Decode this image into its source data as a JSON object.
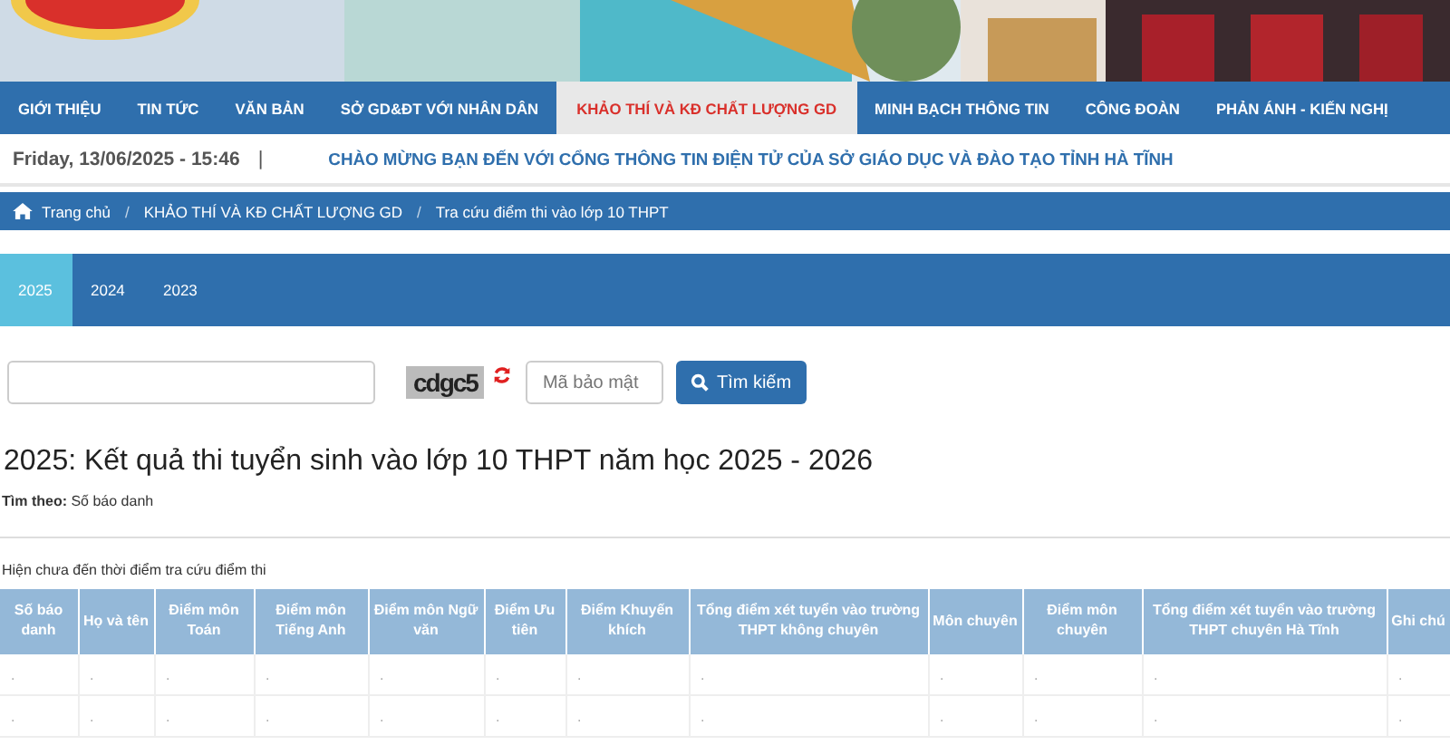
{
  "nav": [
    {
      "label": "GIỚI THIỆU",
      "selected": false
    },
    {
      "label": "TIN TỨC",
      "selected": false
    },
    {
      "label": "VĂN BẢN",
      "selected": false
    },
    {
      "label": "SỞ GD&ĐT VỚI NHÂN DÂN",
      "selected": false
    },
    {
      "label": "KHẢO THÍ VÀ KĐ CHẤT LƯỢNG GD",
      "selected": true
    },
    {
      "label": "MINH BẠCH THÔNG TIN",
      "selected": false
    },
    {
      "label": "CÔNG ĐOÀN",
      "selected": false
    },
    {
      "label": "PHẢN ÁNH - KIẾN NGHỊ",
      "selected": false
    }
  ],
  "date": "Friday, 13/06/2025 - 15:46",
  "separator": "|",
  "welcome": "CHÀO MỪNG BẠN ĐẾN VỚI CỔNG THÔNG TIN ĐIỆN TỬ CỦA SỞ GIÁO DỤC VÀ ĐÀO TẠO TỈNH HÀ TĨNH",
  "breadcrumb": [
    "Trang chủ",
    "KHẢO THÍ VÀ KĐ CHẤT LƯỢNG GD",
    "Tra cứu điểm thi vào lớp 10 THPT"
  ],
  "breadcrumb_separator": "/",
  "year_tabs": [
    {
      "label": "2025",
      "selected": true
    },
    {
      "label": "2024",
      "selected": false
    },
    {
      "label": "2023",
      "selected": false
    }
  ],
  "search": {
    "captcha": "cdgc5",
    "captcha_placeholder": "Mã bảo mật",
    "button": "Tìm kiếm"
  },
  "title": "2025: Kết quả thi tuyển sinh vào lớp 10 THPT năm học 2025 - 2026",
  "search_by": "**Tìm theo:** Số báo danh",
  "notice": "Hiện chưa đến thời điểm tra cứu điểm thi",
  "table": {
    "columns": [
      "Số báo danh",
      "Họ và tên",
      "Điểm môn Toán",
      "Điểm môn Tiếng Anh",
      "Điểm môn Ngữ văn",
      "Điểm Ưu tiên",
      "Điểm Khuyến khích",
      "Tổng điểm xét tuyển vào trường THPT không chuyên",
      "Môn chuyên",
      "Điểm môn chuyên",
      "Tổng điểm xét tuyển vào trường THPT chuyên Hà Tĩnh",
      "Ghi chú"
    ],
    "rows": [
      [
        ".",
        ".",
        ".",
        ".",
        ".",
        ".",
        ".",
        ".",
        ".",
        ".",
        ".",
        "."
      ],
      [
        ".",
        ".",
        ".",
        ".",
        ".",
        ".",
        ".",
        ".",
        ".",
        ".",
        ".",
        "."
      ]
    ]
  }
}
